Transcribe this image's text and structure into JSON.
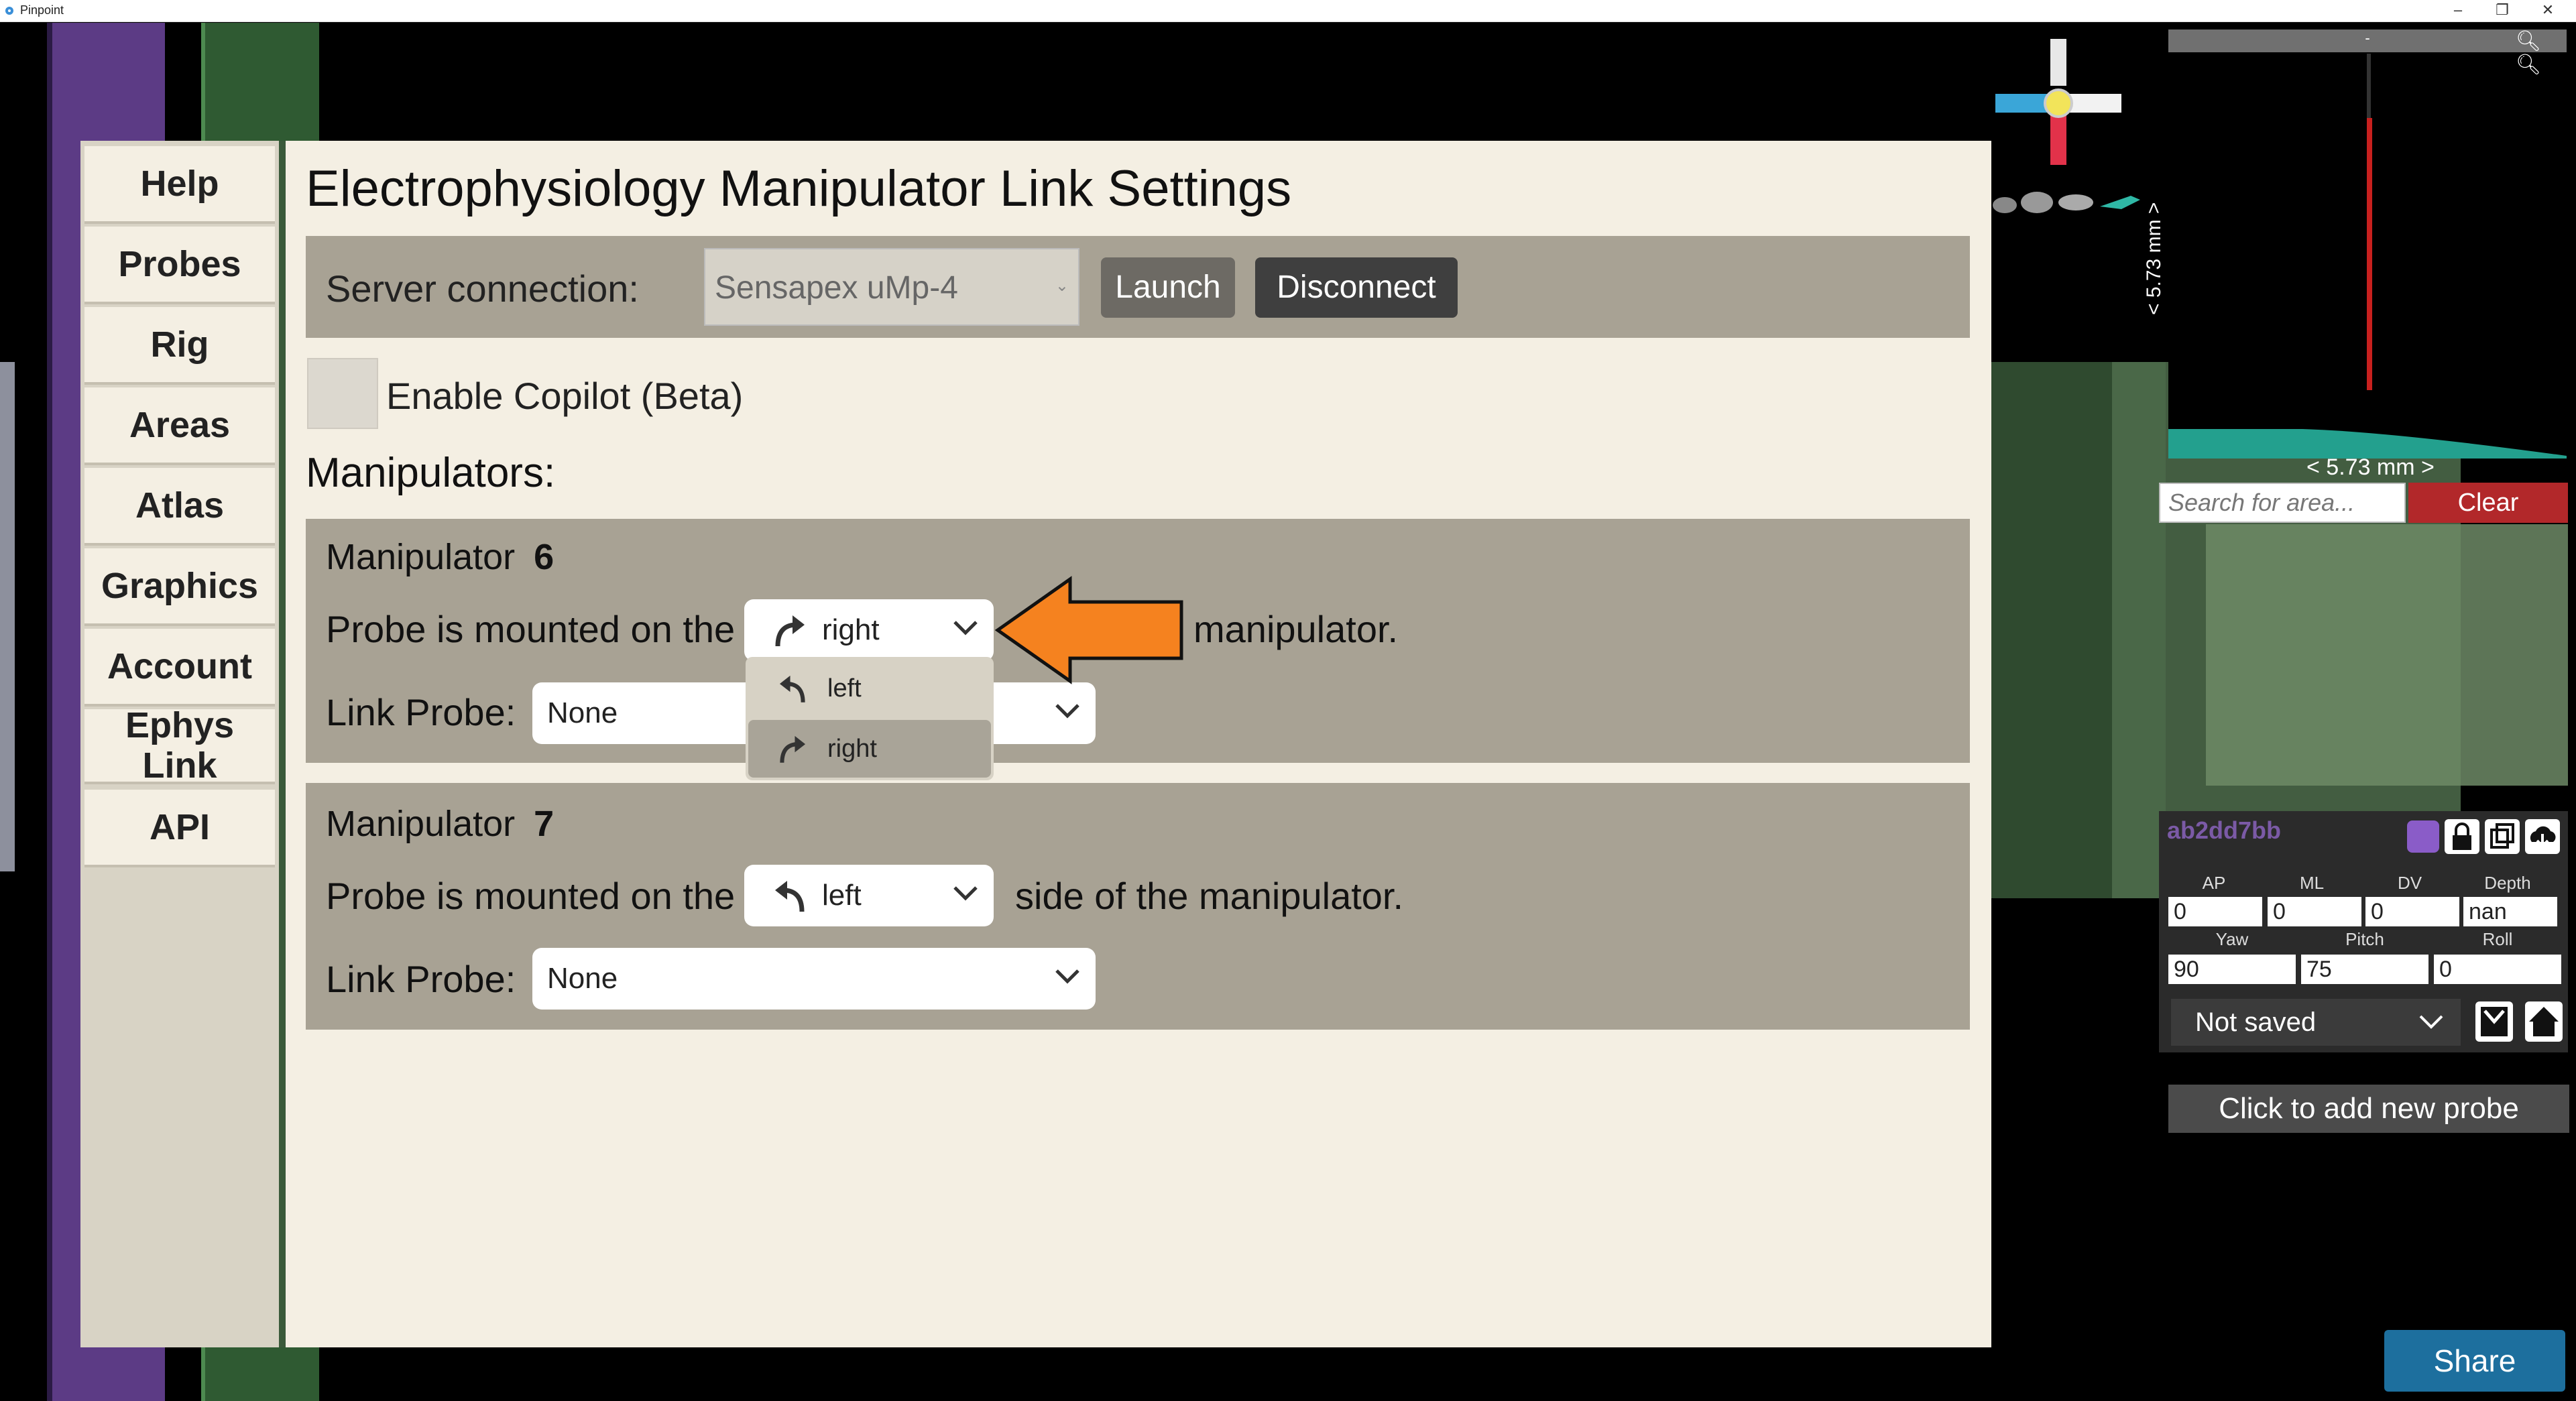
{
  "window": {
    "title": "Pinpoint"
  },
  "nav": [
    "Help",
    "Probes",
    "Rig",
    "Areas",
    "Atlas",
    "Graphics",
    "Account",
    "Ephys Link",
    "API"
  ],
  "page": {
    "title": "Electrophysiology Manipulator Link Settings",
    "server_label": "Server connection:",
    "server_value": "Sensapex uMp-4",
    "launch_label": "Launch",
    "disconnect_label": "Disconnect",
    "copilot_label": "Enable Copilot (Beta)",
    "manipulators_header": "Manipulators:"
  },
  "manipulators": [
    {
      "title": "Manipulator",
      "id": "6",
      "mounted_prefix": "Probe is mounted on the",
      "side": "right",
      "mounted_suffix": "manipulator.",
      "link_label": "Link Probe:",
      "link_value": "None"
    },
    {
      "title": "Manipulator",
      "id": "7",
      "mounted_prefix": "Probe is mounted on the",
      "side": "left",
      "mounted_suffix": "side of the manipulator.",
      "link_label": "Link Probe:",
      "link_value": "None"
    }
  ],
  "side_dropdown_options": [
    "left",
    "right"
  ],
  "right_panel": {
    "topbar_text": "-",
    "scale_vertical": "< 5.73 mm >",
    "scale_horizontal": "< 5.73 mm >",
    "search_placeholder": "Search for area...",
    "clear_label": "Clear",
    "probe_name": "ab2dd7bb",
    "probe_color": "#8a5cc8",
    "fields": {
      "labels": [
        "AP",
        "ML",
        "DV",
        "Depth"
      ],
      "values": [
        "0",
        "0",
        "0",
        "nan"
      ],
      "labels2": [
        "Yaw",
        "Pitch",
        "Roll"
      ],
      "values2": [
        "90",
        "75",
        "0"
      ]
    },
    "save_state": "Not saved",
    "add_probe_label": "Click to add new probe",
    "share_label": "Share"
  },
  "colors": {
    "accent_orange": "#f5821f",
    "clear_red": "#b2282a",
    "share_blue": "#1d6f9e"
  }
}
